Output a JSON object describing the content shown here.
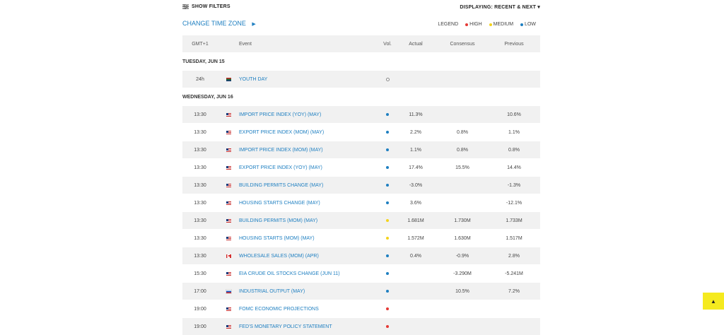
{
  "toolbar": {
    "filters_icon": "filter-sliders-icon",
    "show_filters_label": "SHOW FILTERS",
    "displaying_label": "DISPLAYING: RECENT & NEXT ▾"
  },
  "timezone": {
    "label": "CHANGE TIME ZONE",
    "arrow": "▶"
  },
  "legend": {
    "title": "LEGEND",
    "high": "HIGH",
    "medium": "MEDIUM",
    "low": "LOW",
    "colors": {
      "high": "#e53935",
      "medium": "#f4d31c",
      "low": "#1e7fc1"
    }
  },
  "table": {
    "headers": {
      "time": "GMT+1",
      "event": "Event",
      "vol": "Vol.",
      "actual": "Actual",
      "consensus": "Consensus",
      "previous": "Previous"
    },
    "days": [
      {
        "label": "TUESDAY, JUN 15",
        "events": [
          {
            "time": "24h",
            "flag": "za",
            "event": "YOUTH DAY",
            "vol": "none",
            "actual": "",
            "consensus": "",
            "previous": ""
          }
        ]
      },
      {
        "label": "WEDNESDAY, JUN 16",
        "events": [
          {
            "time": "13:30",
            "flag": "us",
            "event": "IMPORT PRICE INDEX (YOY) (MAY)",
            "vol": "low",
            "actual": "11.3%",
            "consensus": "",
            "previous": "10.6%"
          },
          {
            "time": "13:30",
            "flag": "us",
            "event": "EXPORT PRICE INDEX (MOM) (MAY)",
            "vol": "low",
            "actual": "2.2%",
            "consensus": "0.8%",
            "previous": "1.1%"
          },
          {
            "time": "13:30",
            "flag": "us",
            "event": "IMPORT PRICE INDEX (MOM) (MAY)",
            "vol": "low",
            "actual": "1.1%",
            "consensus": "0.8%",
            "previous": "0.8%"
          },
          {
            "time": "13:30",
            "flag": "us",
            "event": "EXPORT PRICE INDEX (YOY) (MAY)",
            "vol": "low",
            "actual": "17.4%",
            "consensus": "15.5%",
            "previous": "14.4%"
          },
          {
            "time": "13:30",
            "flag": "us",
            "event": "BUILDING PERMITS CHANGE (MAY)",
            "vol": "low",
            "actual": "-3.0%",
            "consensus": "",
            "previous": "-1.3%"
          },
          {
            "time": "13:30",
            "flag": "us",
            "event": "HOUSING STARTS CHANGE (MAY)",
            "vol": "low",
            "actual": "3.6%",
            "consensus": "",
            "previous": "-12.1%"
          },
          {
            "time": "13:30",
            "flag": "us",
            "event": "BUILDING PERMITS (MOM) (MAY)",
            "vol": "medium",
            "actual": "1.681M",
            "consensus": "1.730M",
            "previous": "1.733M"
          },
          {
            "time": "13:30",
            "flag": "us",
            "event": "HOUSING STARTS (MOM) (MAY)",
            "vol": "medium",
            "actual": "1.572M",
            "consensus": "1.630M",
            "previous": "1.517M"
          },
          {
            "time": "13:30",
            "flag": "ca",
            "event": "WHOLESALE SALES (MOM) (APR)",
            "vol": "low",
            "actual": "0.4%",
            "consensus": "-0.9%",
            "previous": "2.8%"
          },
          {
            "time": "15:30",
            "flag": "us",
            "event": "EIA CRUDE OIL STOCKS CHANGE (JUN 11)",
            "vol": "low",
            "actual": "",
            "consensus": "-3.290M",
            "previous": "-5.241M"
          },
          {
            "time": "17:00",
            "flag": "ru",
            "event": "INDUSTRIAL OUTPUT (MAY)",
            "vol": "low",
            "actual": "",
            "consensus": "10.5%",
            "previous": "7.2%"
          },
          {
            "time": "19:00",
            "flag": "us",
            "event": "FOMC ECONOMIC PROJECTIONS",
            "vol": "high",
            "actual": "",
            "consensus": "",
            "previous": ""
          },
          {
            "time": "19:00",
            "flag": "us",
            "event": "FED'S MONETARY POLICY STATEMENT",
            "vol": "high",
            "actual": "",
            "consensus": "",
            "previous": ""
          }
        ]
      }
    ]
  },
  "scroll_top": {
    "label": "▲",
    "color": "#f5ea1f"
  }
}
